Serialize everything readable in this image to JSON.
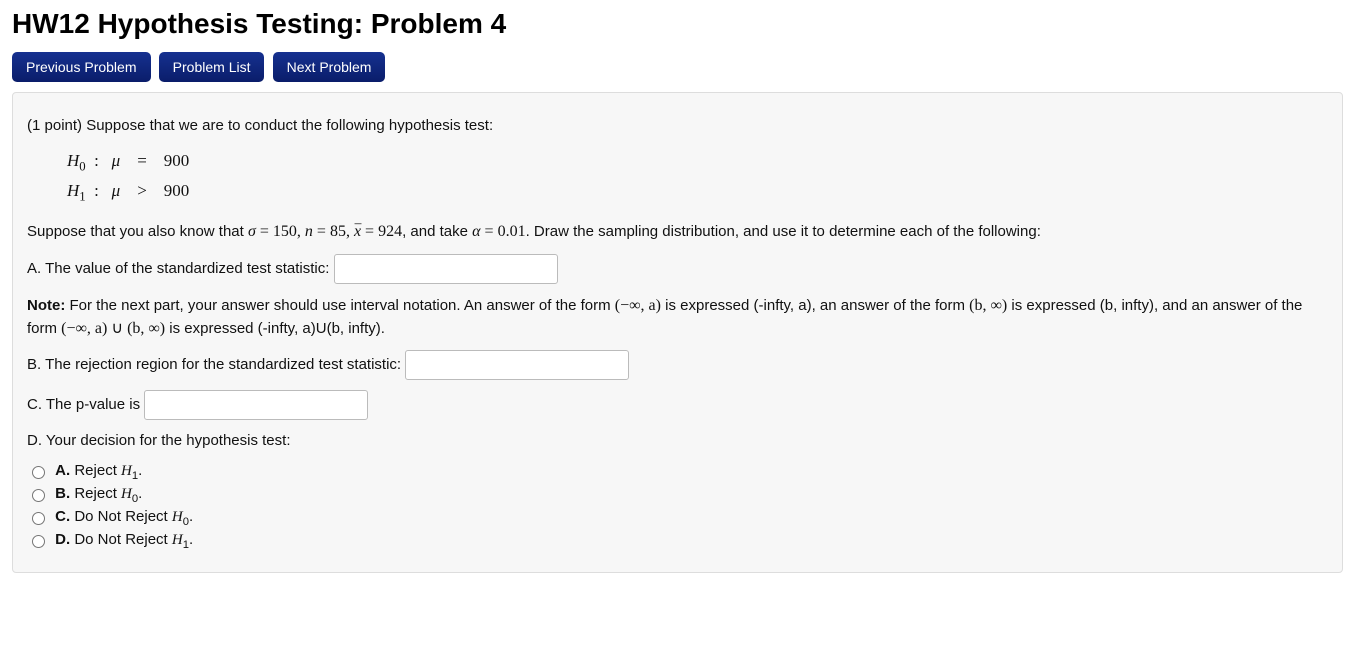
{
  "title": "HW12 Hypothesis Testing: Problem 4",
  "nav": {
    "prev": "Previous Problem",
    "list": "Problem List",
    "next": "Next Problem"
  },
  "intro": "(1 point) Suppose that we are to conduct the following hypothesis test:",
  "hypotheses": {
    "h0_label": "H",
    "h0_sub": "0",
    "h0_rel": "=",
    "h0_val": "900",
    "h1_label": "H",
    "h1_sub": "1",
    "h1_rel": ">",
    "h1_val": "900",
    "param": "μ"
  },
  "known": {
    "prefix": "Suppose that you also know that ",
    "sigma_sym": "σ",
    "sigma": "150",
    "n_sym": "n",
    "n": "85",
    "xbar_sym": "x",
    "xbar": "924",
    "alpha_sym": "α",
    "alpha": "0.01",
    "suffix": ". Draw the sampling distribution, and use it to determine each of the following:"
  },
  "partA": "A. The value of the standardized test statistic:",
  "note_label": "Note:",
  "note_text1": " For the next part, your answer should use interval notation. An answer of the form ",
  "note_int1": "(−∞, a)",
  "note_text2": " is expressed (-infty, a), an answer of the form ",
  "note_int2": "(b, ∞)",
  "note_text3": " is expressed (b, infty), and an answer of the form ",
  "note_int3": "(−∞, a) ∪ (b, ∞)",
  "note_text4": " is expressed (-infty, a)U(b, infty).",
  "partB": "B. The rejection region for the standardized test statistic:",
  "partC": "C. The p-value is",
  "partD": "D. Your decision for the hypothesis test:",
  "options": {
    "a_label": "A.",
    "a_text": " Reject ",
    "a_sym": "H",
    "a_sub": "1",
    "a_punct": ".",
    "b_label": "B.",
    "b_text": " Reject ",
    "b_sym": "H",
    "b_sub": "0",
    "b_punct": ".",
    "c_label": "C.",
    "c_text": " Do Not Reject ",
    "c_sym": "H",
    "c_sub": "0",
    "c_punct": ".",
    "d_label": "D.",
    "d_text": " Do Not Reject ",
    "d_sym": "H",
    "d_sub": "1",
    "d_punct": "."
  }
}
